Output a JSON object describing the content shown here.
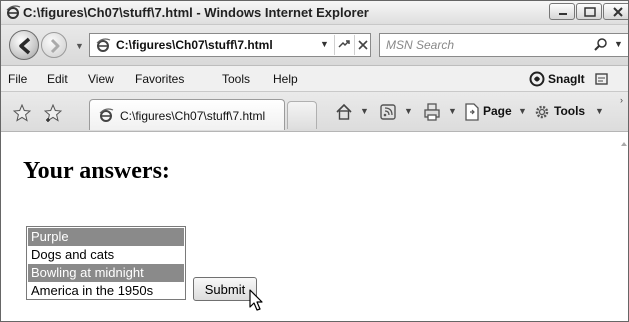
{
  "window": {
    "title": "C:\\figures\\Ch07\\stuff\\7.html - Windows Internet Explorer",
    "controls": [
      "minimize-icon",
      "maximize-icon",
      "close-icon"
    ]
  },
  "address_bar": {
    "url": "C:\\figures\\Ch07\\stuff\\7.html"
  },
  "search": {
    "placeholder": "MSN Search"
  },
  "menu": {
    "items": [
      "File",
      "Edit",
      "View",
      "Favorites",
      "Tools",
      "Help"
    ],
    "snagit_label": "SnagIt"
  },
  "tab": {
    "label": "C:\\figures\\Ch07\\stuff\\7.html"
  },
  "commands": {
    "page_label": "Page",
    "tools_label": "Tools"
  },
  "page": {
    "heading": "Your answers:",
    "options": [
      {
        "label": "Purple",
        "selected": true
      },
      {
        "label": "Dogs and cats",
        "selected": false
      },
      {
        "label": "Bowling at midnight",
        "selected": true
      },
      {
        "label": "America in the 1950s",
        "selected": false
      }
    ],
    "submit_label": "Submit"
  },
  "colors": {
    "selected_option_bg": "#8a8a8a",
    "selected_option_text": "#ffffff"
  }
}
